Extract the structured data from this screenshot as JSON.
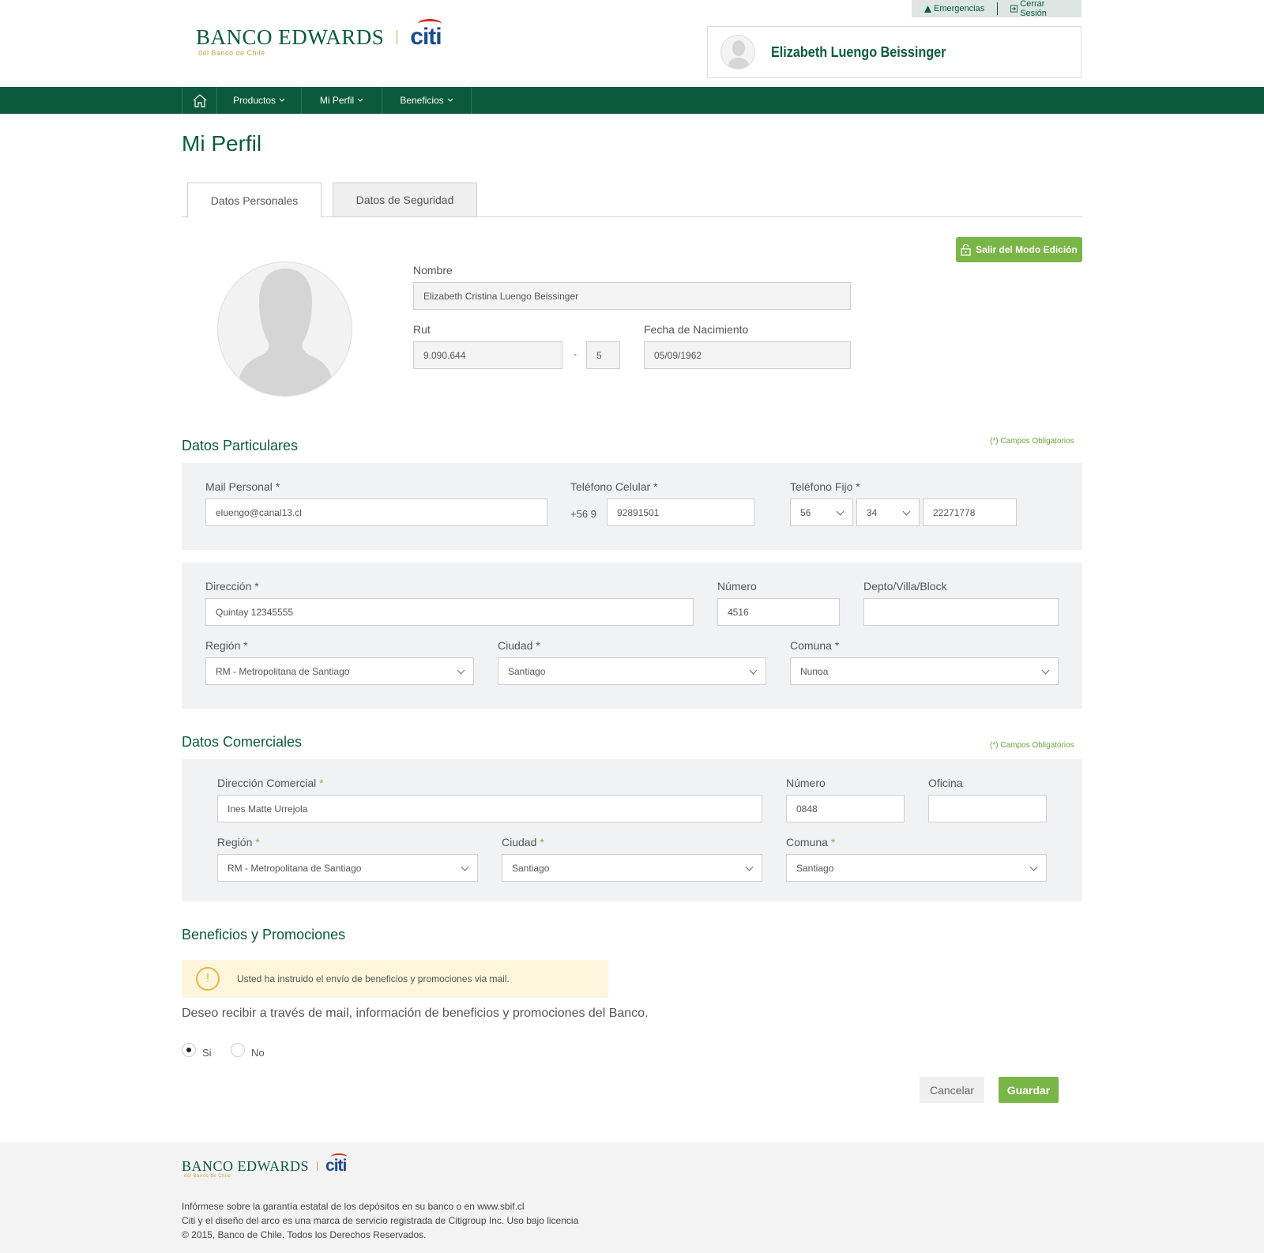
{
  "header": {
    "util": {
      "emergencias": "Emergencias",
      "cerrar_sesion": "Cerrar Sesión"
    },
    "logo": {
      "brand": "BANCO EDWARDS",
      "citi": "citi",
      "sub": "del Banco de Chile"
    },
    "user_name": "Elizabeth Luengo Beissinger"
  },
  "nav": {
    "items": [
      "Productos",
      "Mi Perfil",
      "Beneficios"
    ]
  },
  "page_title": "Mi Perfil",
  "tabs": [
    "Datos Personales",
    "Datos de Seguridad"
  ],
  "edit_button": "Salir del Modo Edición",
  "personal": {
    "nombre_label": "Nombre",
    "nombre": "Elizabeth Cristina Luengo Beissinger",
    "rut_label": "Rut",
    "rut": "9.090.644",
    "rut_dash": "-",
    "rut_dv": "5",
    "fecha_label": "Fecha de Nacimiento",
    "fecha": "05/09/1962"
  },
  "particulares": {
    "title": "Datos Particulares",
    "req_note": "(*) Campos Obligatorios",
    "mail_label": "Mail Personal *",
    "mail": "eluengo@canal13.cl",
    "cel_label": "Teléfono Celular *",
    "cel_prefix": "+56 9",
    "cel": "92891501",
    "fijo_label": "Teléfono Fijo *",
    "fijo_country": "56",
    "fijo_area": "34",
    "fijo_number": "22271778",
    "direccion_label": "Dirección *",
    "direccion": "Quintay 12345555",
    "numero_label": "Número",
    "numero": "4516",
    "depto_label": "Depto/Villa/Block",
    "depto": "",
    "region_label": "Región *",
    "region": "RM - Metropolitana de Santiago",
    "ciudad_label": "Ciudad *",
    "ciudad": "Santiago",
    "comuna_label": "Comuna *",
    "comuna": "Nunoa"
  },
  "comerciales": {
    "title": "Datos Comerciales",
    "req_note": "(*) Campos Obligatorios",
    "direccion_label": "Dirección Comercial",
    "direccion": "Ines Matte Urrejola",
    "numero_label": "Número",
    "numero": "0848",
    "oficina_label": "Oficina",
    "oficina": "",
    "region_label": "Región",
    "region": "RM - Metropolitana de Santiago",
    "ciudad_label": "Ciudad",
    "ciudad": "Santiago",
    "comuna_label": "Comuna",
    "comuna": "Santiago",
    "asterisk": "*"
  },
  "beneficios": {
    "title": "Beneficios y Promociones",
    "alert_icon": "!",
    "alert": "Usted ha instruido el envío de beneficios y promociones via mail.",
    "question": "Deseo recibir a través de mail, información de beneficios y promociones del Banco.",
    "si": "Si",
    "no": "No",
    "selected": "Si"
  },
  "actions": {
    "cancel": "Cancelar",
    "save": "Guardar"
  },
  "footer": {
    "legal": [
      "Infórmese sobre la garantía estatal de los depósitos en su banco o en www.sbif.cl",
      "Citi y el diseño del arco es una marca de servicio registrada de Citigroup Inc. Uso bajo licencia",
      "© 2015, Banco de Chile. Todos los Derechos Reservados."
    ]
  },
  "colors": {
    "brand_green": "#0b5a3e",
    "accent_green": "#7ab547",
    "citi_blue": "#1c4a8c",
    "citi_red": "#d52b1e",
    "gold": "#c8a24a"
  }
}
